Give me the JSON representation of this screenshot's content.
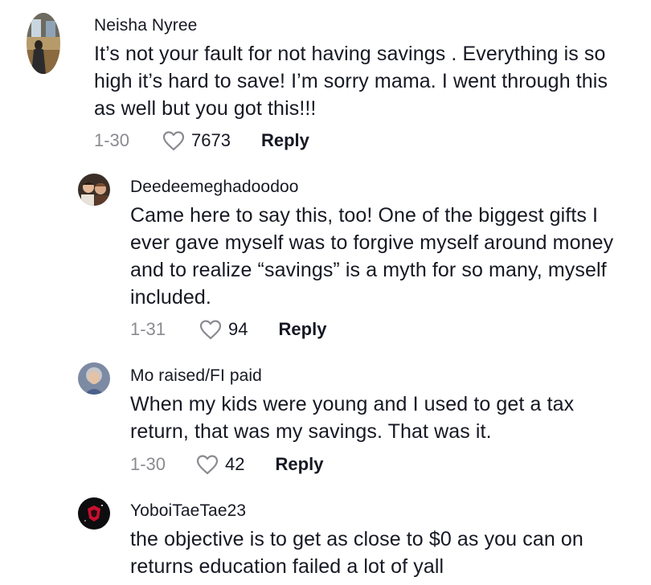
{
  "comments": [
    {
      "author": "Neisha Nyree",
      "text": "It’s not your fault for not having savings . Everything is so high it’s hard to save! I’m sorry mama. I went through this as well but you got this!!!",
      "date": "1-30",
      "likes": "7673",
      "reply_label": "Reply",
      "avatar_icon": "avatar-photo-figure-window"
    },
    {
      "author": "Deedeemeghadoodoo",
      "text": "Came here to say this, too! One of the biggest gifts I ever gave myself was to forgive myself around money and to realize “savings” is a myth for so many, myself included.",
      "date": "1-31",
      "likes": "94",
      "reply_label": "Reply",
      "avatar_icon": "avatar-photo-group"
    },
    {
      "author": "Mo raised/FI paid",
      "text": "When my kids were young and I used to get a tax return, that was my savings. That was it.",
      "date": "1-30",
      "likes": "42",
      "reply_label": "Reply",
      "avatar_icon": "avatar-photo-person"
    },
    {
      "author": "YoboiTaeTae23",
      "text": "the objective is to get as close to $0 as you can on returns education failed a lot of yall",
      "avatar_icon": "avatar-logo-red-on-black"
    }
  ],
  "colors": {
    "text": "#161823",
    "muted": "#8a8b91",
    "background": "#ffffff"
  }
}
